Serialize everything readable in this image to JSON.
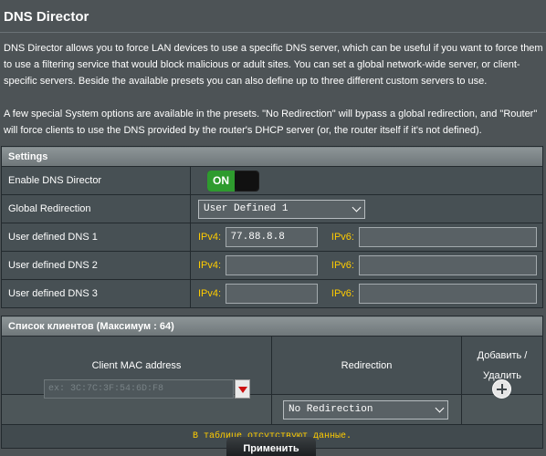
{
  "page": {
    "title": "DNS Director",
    "description_1": "DNS Director allows you to force LAN devices to use a specific DNS server, which can be useful if you want to force them to use a filtering service that would block malicious or adult sites. You can set a global network-wide server, or client-specific servers. Beside the available presets you can also define up to three different custom servers to use.",
    "description_2": "A few special System options are available in the presets. \"No Redirection\" will bypass a global redirection, and \"Router\" will force clients to use the DNS provided by the router's DHCP server (or, the router itself if it's not defined)."
  },
  "settings": {
    "header": "Settings",
    "enable_label": "Enable DNS Director",
    "enable_state": "ON",
    "global_label": "Global Redirection",
    "global_value": "User Defined 1",
    "ipv4_label": "IPv4:",
    "ipv6_label": "IPv6:",
    "dns": [
      {
        "label": "User defined DNS 1",
        "ipv4": "77.88.8.8",
        "ipv6": ""
      },
      {
        "label": "User defined DNS 2",
        "ipv4": "",
        "ipv6": ""
      },
      {
        "label": "User defined DNS 3",
        "ipv4": "",
        "ipv6": ""
      }
    ]
  },
  "clients": {
    "header": "Список клиентов (Максимум : 64)",
    "col_mac": "Client MAC address",
    "col_redirection": "Redirection",
    "col_action_1": "Добавить /",
    "col_action_2": "Удалить",
    "mac_placeholder": "ex: 3C:7C:3F:54:6D:F8",
    "redirection_value": "No Redirection",
    "no_data": "В таблице отсутствуют данные."
  },
  "actions": {
    "apply": "Применить"
  },
  "colors": {
    "background": "#4d5356",
    "on_green": "#2e9b2e",
    "ip_label_yellow": "#ffcc00",
    "drop_arrow_red": "#cc1111"
  },
  "icons": {
    "add": "plus-circle-icon",
    "dropdown": "chevron-down-icon",
    "mac_dropdown": "triangle-down-icon"
  }
}
